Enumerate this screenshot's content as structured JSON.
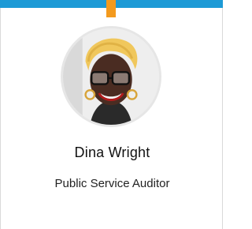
{
  "profile": {
    "name": "Dina Wright",
    "title": "Public Service Auditor",
    "photo_icon": "avatar-photo"
  },
  "colors": {
    "top_bar": "#1d9ad6",
    "top_tab": "#f39a1e",
    "border": "#d9d9d9"
  }
}
